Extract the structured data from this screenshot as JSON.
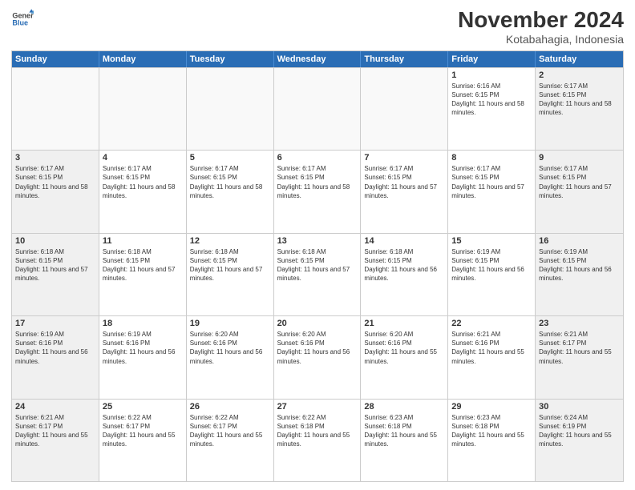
{
  "logo": {
    "line1": "General",
    "line2": "Blue"
  },
  "title": "November 2024",
  "subtitle": "Kotabahagia, Indonesia",
  "header": {
    "days": [
      "Sunday",
      "Monday",
      "Tuesday",
      "Wednesday",
      "Thursday",
      "Friday",
      "Saturday"
    ]
  },
  "weeks": [
    [
      {
        "day": "",
        "info": ""
      },
      {
        "day": "",
        "info": ""
      },
      {
        "day": "",
        "info": ""
      },
      {
        "day": "",
        "info": ""
      },
      {
        "day": "",
        "info": ""
      },
      {
        "day": "1",
        "info": "Sunrise: 6:16 AM\nSunset: 6:15 PM\nDaylight: 11 hours and 58 minutes."
      },
      {
        "day": "2",
        "info": "Sunrise: 6:17 AM\nSunset: 6:15 PM\nDaylight: 11 hours and 58 minutes."
      }
    ],
    [
      {
        "day": "3",
        "info": "Sunrise: 6:17 AM\nSunset: 6:15 PM\nDaylight: 11 hours and 58 minutes."
      },
      {
        "day": "4",
        "info": "Sunrise: 6:17 AM\nSunset: 6:15 PM\nDaylight: 11 hours and 58 minutes."
      },
      {
        "day": "5",
        "info": "Sunrise: 6:17 AM\nSunset: 6:15 PM\nDaylight: 11 hours and 58 minutes."
      },
      {
        "day": "6",
        "info": "Sunrise: 6:17 AM\nSunset: 6:15 PM\nDaylight: 11 hours and 58 minutes."
      },
      {
        "day": "7",
        "info": "Sunrise: 6:17 AM\nSunset: 6:15 PM\nDaylight: 11 hours and 57 minutes."
      },
      {
        "day": "8",
        "info": "Sunrise: 6:17 AM\nSunset: 6:15 PM\nDaylight: 11 hours and 57 minutes."
      },
      {
        "day": "9",
        "info": "Sunrise: 6:17 AM\nSunset: 6:15 PM\nDaylight: 11 hours and 57 minutes."
      }
    ],
    [
      {
        "day": "10",
        "info": "Sunrise: 6:18 AM\nSunset: 6:15 PM\nDaylight: 11 hours and 57 minutes."
      },
      {
        "day": "11",
        "info": "Sunrise: 6:18 AM\nSunset: 6:15 PM\nDaylight: 11 hours and 57 minutes."
      },
      {
        "day": "12",
        "info": "Sunrise: 6:18 AM\nSunset: 6:15 PM\nDaylight: 11 hours and 57 minutes."
      },
      {
        "day": "13",
        "info": "Sunrise: 6:18 AM\nSunset: 6:15 PM\nDaylight: 11 hours and 57 minutes."
      },
      {
        "day": "14",
        "info": "Sunrise: 6:18 AM\nSunset: 6:15 PM\nDaylight: 11 hours and 56 minutes."
      },
      {
        "day": "15",
        "info": "Sunrise: 6:19 AM\nSunset: 6:15 PM\nDaylight: 11 hours and 56 minutes."
      },
      {
        "day": "16",
        "info": "Sunrise: 6:19 AM\nSunset: 6:15 PM\nDaylight: 11 hours and 56 minutes."
      }
    ],
    [
      {
        "day": "17",
        "info": "Sunrise: 6:19 AM\nSunset: 6:16 PM\nDaylight: 11 hours and 56 minutes."
      },
      {
        "day": "18",
        "info": "Sunrise: 6:19 AM\nSunset: 6:16 PM\nDaylight: 11 hours and 56 minutes."
      },
      {
        "day": "19",
        "info": "Sunrise: 6:20 AM\nSunset: 6:16 PM\nDaylight: 11 hours and 56 minutes."
      },
      {
        "day": "20",
        "info": "Sunrise: 6:20 AM\nSunset: 6:16 PM\nDaylight: 11 hours and 56 minutes."
      },
      {
        "day": "21",
        "info": "Sunrise: 6:20 AM\nSunset: 6:16 PM\nDaylight: 11 hours and 55 minutes."
      },
      {
        "day": "22",
        "info": "Sunrise: 6:21 AM\nSunset: 6:16 PM\nDaylight: 11 hours and 55 minutes."
      },
      {
        "day": "23",
        "info": "Sunrise: 6:21 AM\nSunset: 6:17 PM\nDaylight: 11 hours and 55 minutes."
      }
    ],
    [
      {
        "day": "24",
        "info": "Sunrise: 6:21 AM\nSunset: 6:17 PM\nDaylight: 11 hours and 55 minutes."
      },
      {
        "day": "25",
        "info": "Sunrise: 6:22 AM\nSunset: 6:17 PM\nDaylight: 11 hours and 55 minutes."
      },
      {
        "day": "26",
        "info": "Sunrise: 6:22 AM\nSunset: 6:17 PM\nDaylight: 11 hours and 55 minutes."
      },
      {
        "day": "27",
        "info": "Sunrise: 6:22 AM\nSunset: 6:18 PM\nDaylight: 11 hours and 55 minutes."
      },
      {
        "day": "28",
        "info": "Sunrise: 6:23 AM\nSunset: 6:18 PM\nDaylight: 11 hours and 55 minutes."
      },
      {
        "day": "29",
        "info": "Sunrise: 6:23 AM\nSunset: 6:18 PM\nDaylight: 11 hours and 55 minutes."
      },
      {
        "day": "30",
        "info": "Sunrise: 6:24 AM\nSunset: 6:19 PM\nDaylight: 11 hours and 55 minutes."
      }
    ]
  ]
}
